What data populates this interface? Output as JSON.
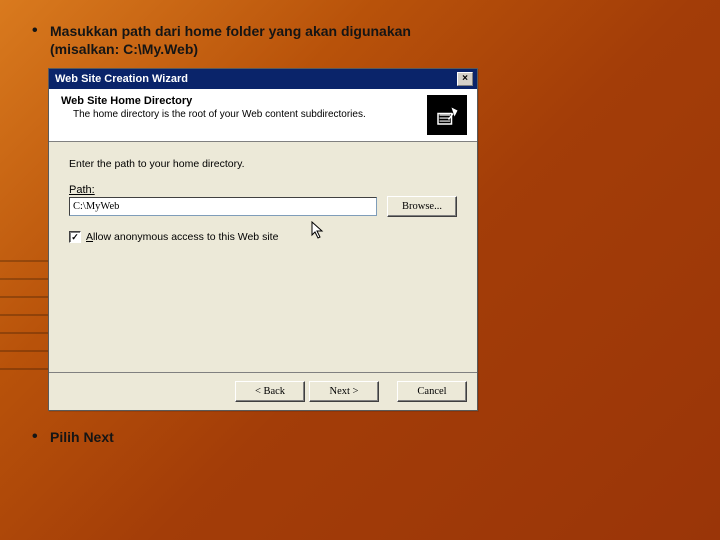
{
  "bullets": {
    "top_line1": "Masukkan path dari home folder yang akan digunakan",
    "top_line2": "(misalkan: C:\\My.Web)",
    "bottom": "Pilih Next"
  },
  "dialog": {
    "title": "Web Site Creation Wizard",
    "header_title": "Web Site Home Directory",
    "header_sub": "The home directory is the root of your Web content subdirectories.",
    "instruction": "Enter the path to your home directory.",
    "path_label": "Path:",
    "path_value": "C:\\MyWeb",
    "browse_label": "Browse...",
    "checkbox_label_pre": "A",
    "checkbox_label_rest": "llow anonymous access to this Web site",
    "checkbox_checked": "✓",
    "btn_back": "< Back",
    "btn_next": "Next >",
    "btn_cancel": "Cancel"
  }
}
